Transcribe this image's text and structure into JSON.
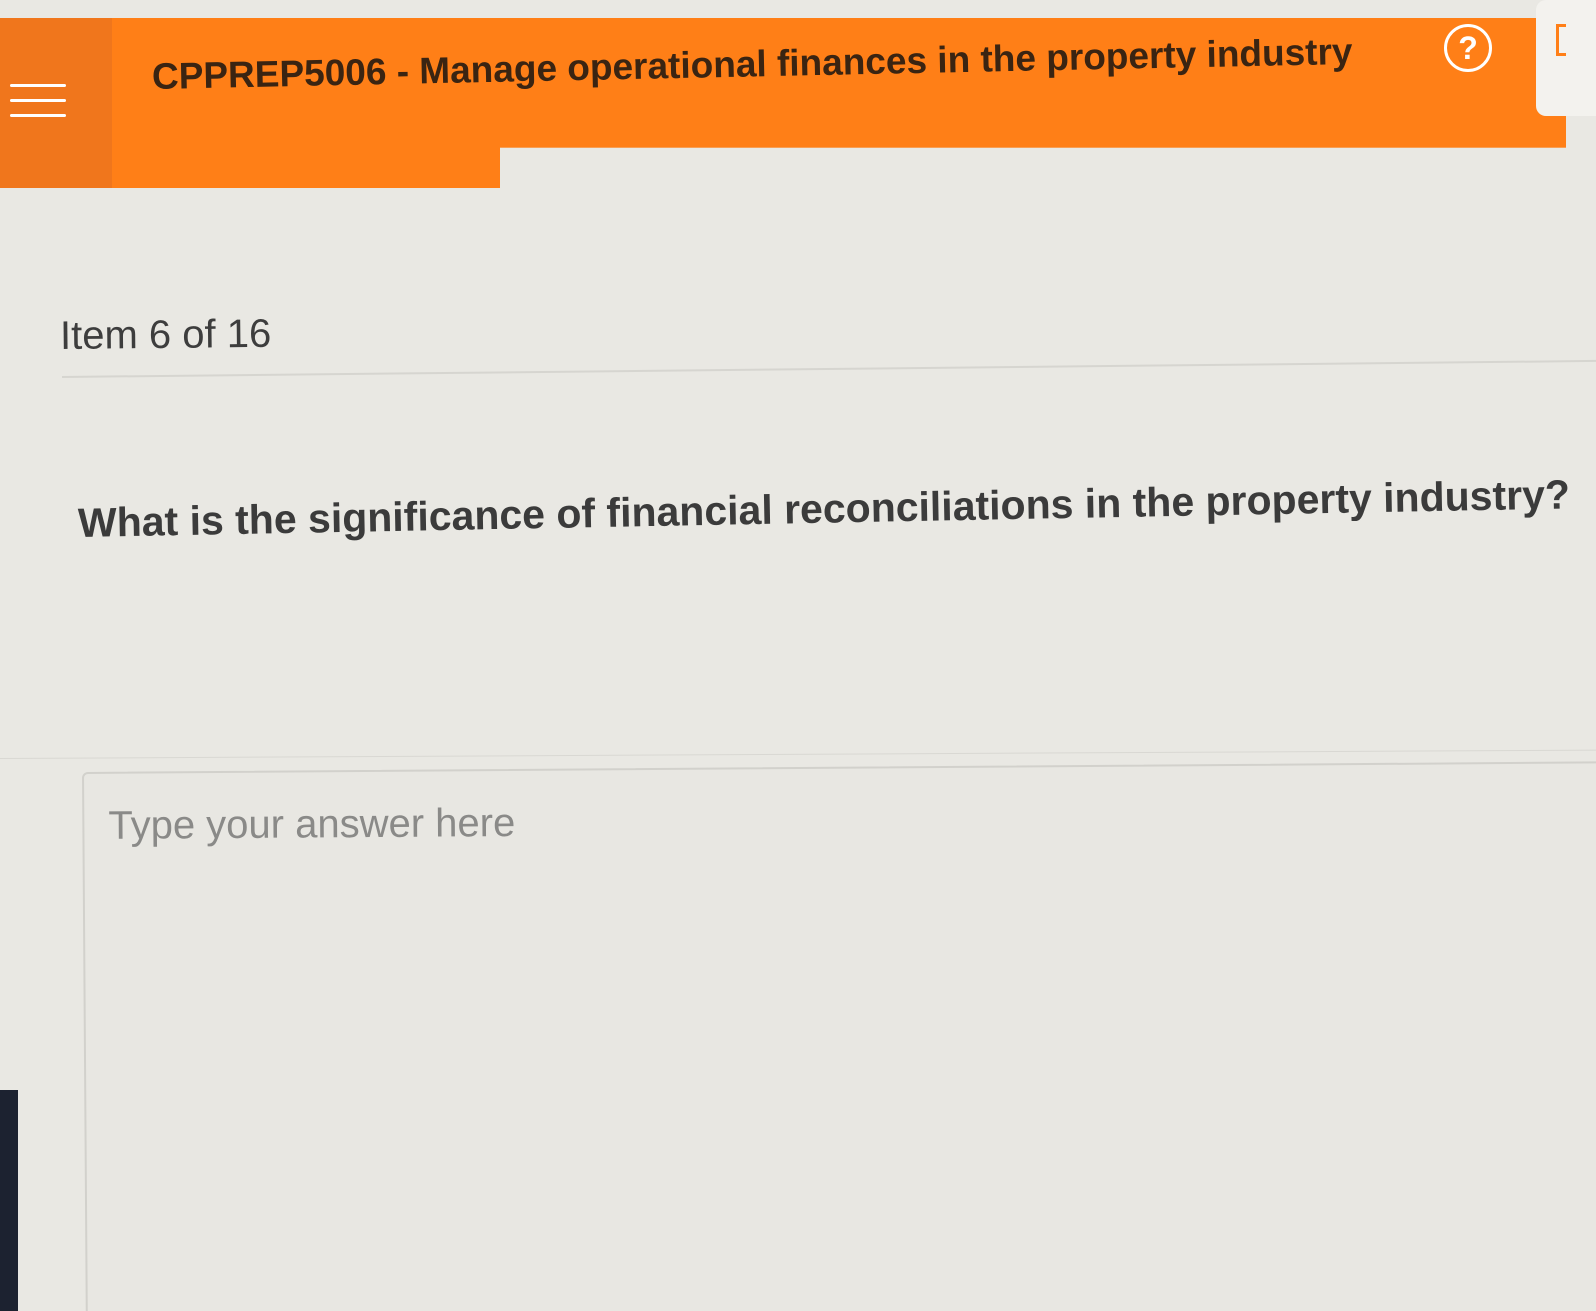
{
  "header": {
    "title": "CPPREP5006 - Manage operational finances in the property industry",
    "help_label": "?"
  },
  "content": {
    "item_counter": "Item 6 of 16",
    "question": "What is the significance of financial reconciliations in the property industry?",
    "answer_placeholder": "Type your answer here",
    "answer_value": ""
  },
  "colors": {
    "accent": "#ff7f17",
    "background": "#e9e8e3",
    "text": "#3b3b3b"
  },
  "icons": {
    "menu": "hamburger-menu-icon",
    "help": "help-circle-icon"
  }
}
